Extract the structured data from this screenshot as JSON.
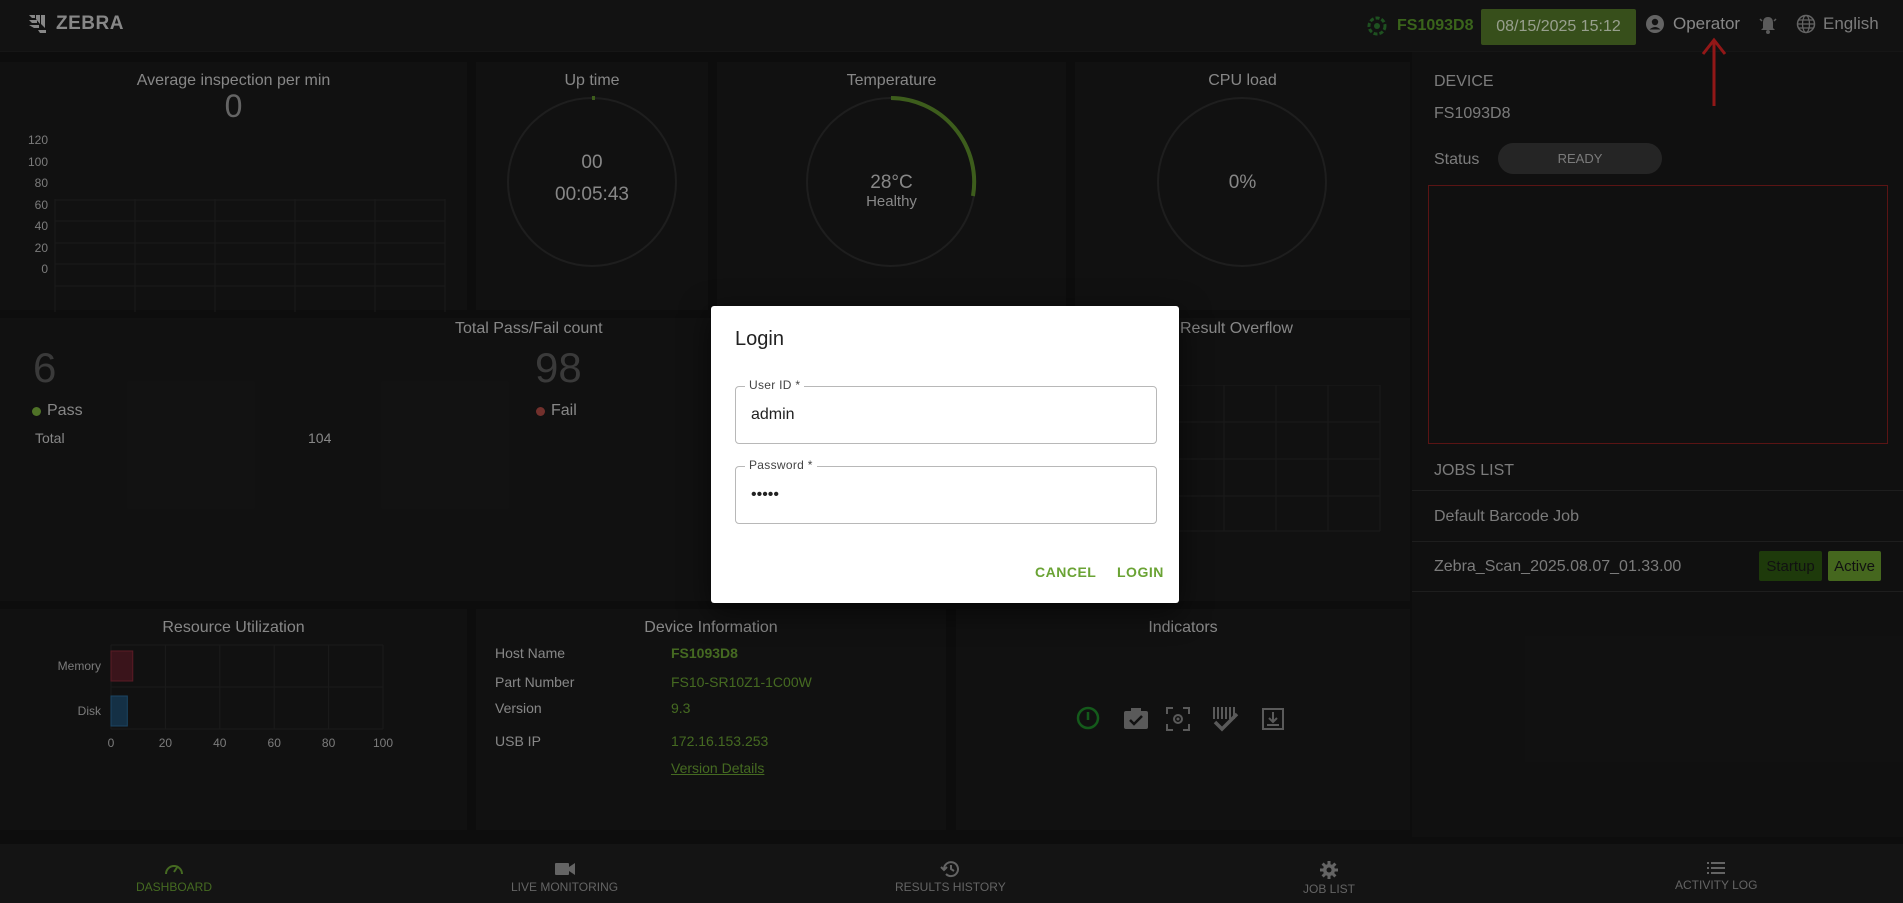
{
  "brand": {
    "logo_text": "ZEBRA"
  },
  "header": {
    "device_serial": "FS1093D8",
    "datetime": "08/15/2025 15:12",
    "user": "Operator",
    "language": "English"
  },
  "panels": {
    "avg_inspection": {
      "title": "Average inspection per min",
      "value": "0",
      "y_ticks": [
        "120",
        "100",
        "80",
        "60",
        "40",
        "20",
        "0"
      ]
    },
    "uptime": {
      "title": "Up time",
      "days": "00",
      "time": "00:05:43"
    },
    "temperature": {
      "title": "Temperature",
      "value": "28°C",
      "status": "Healthy"
    },
    "cpu": {
      "title": "CPU load",
      "value": "0%"
    },
    "passfail": {
      "title": "Total Pass/Fail count",
      "pass_count": "6",
      "pass_label": "Pass",
      "fail_count": "98",
      "fail_label": "Fail",
      "total_label": "Total",
      "total_value": "104"
    },
    "overflow": {
      "title": "Result Overflow"
    },
    "resource": {
      "title": "Resource Utilization",
      "rows": [
        {
          "label": "Memory",
          "value": 8,
          "color": "#5a1f2a"
        },
        {
          "label": "Disk",
          "value": 6,
          "color": "#1f4a6a"
        }
      ],
      "x_ticks": [
        "0",
        "20",
        "40",
        "60",
        "80",
        "100"
      ]
    },
    "device_info": {
      "title": "Device Information",
      "rows": [
        {
          "label": "Host Name",
          "value": "FS1093D8"
        },
        {
          "label": "Part Number",
          "value": "FS10-SR10Z1-1C00W"
        },
        {
          "label": "Version",
          "value": "9.3"
        },
        {
          "label": "USB IP",
          "value": "172.16.153.253"
        }
      ],
      "link": "Version Details"
    },
    "indicators": {
      "title": "Indicators"
    }
  },
  "sidebar": {
    "device_label": "DEVICE",
    "device_name": "FS1093D8",
    "status_label": "Status",
    "status_value": "READY",
    "jobs_label": "JOBS LIST",
    "jobs": [
      {
        "name": "Default Barcode Job"
      },
      {
        "name": "Zebra_Scan_2025.08.07_01.33.00",
        "badge1": "Startup",
        "badge2": "Active"
      }
    ]
  },
  "nav": [
    {
      "label": "DASHBOARD",
      "icon": "speedometer-icon",
      "active": true
    },
    {
      "label": "LIVE MONITORING",
      "icon": "video-camera-icon"
    },
    {
      "label": "RESULTS HISTORY",
      "icon": "history-icon"
    },
    {
      "label": "JOB LIST",
      "icon": "gear-icon"
    },
    {
      "label": "ACTIVITY LOG",
      "icon": "list-icon"
    }
  ],
  "login": {
    "title": "Login",
    "user_label": "User ID *",
    "user_value": "admin",
    "password_label": "Password *",
    "password_value": "•••••",
    "cancel": "CANCEL",
    "login": "LOGIN"
  },
  "colors": {
    "accent": "#6aa334",
    "pass": "#7ab03c",
    "fail": "#b04a44",
    "datetime_bg": "#557a2a"
  }
}
